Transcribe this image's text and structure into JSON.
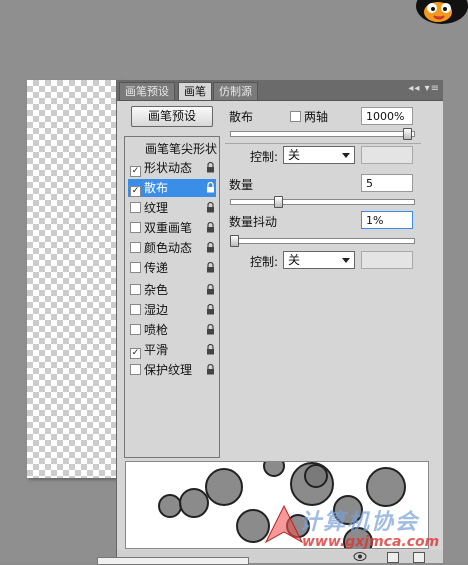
{
  "tabs": [
    {
      "label": "画笔预设",
      "active": false
    },
    {
      "label": "画笔",
      "active": true
    },
    {
      "label": "仿制源",
      "active": false
    }
  ],
  "tabbar_buttons": "◂◂ ▾≡",
  "preset_button": "画笔预设",
  "brush_tip_header": "画笔笔尖形状",
  "left_items": [
    {
      "label": "形状动态",
      "checked": true,
      "selected": false
    },
    {
      "label": "散布",
      "checked": true,
      "selected": true
    },
    {
      "label": "纹理",
      "checked": false,
      "selected": false
    },
    {
      "label": "双重画笔",
      "checked": false,
      "selected": false
    },
    {
      "label": "颜色动态",
      "checked": false,
      "selected": false
    },
    {
      "label": "传递",
      "checked": false,
      "selected": false
    },
    {
      "label": "杂色",
      "checked": false,
      "selected": false
    },
    {
      "label": "湿边",
      "checked": false,
      "selected": false
    },
    {
      "label": "喷枪",
      "checked": false,
      "selected": false
    },
    {
      "label": "平滑",
      "checked": true,
      "selected": false
    },
    {
      "label": "保护纹理",
      "checked": false,
      "selected": false
    }
  ],
  "scatter": {
    "label": "散布",
    "both_axes_label": "两轴",
    "both_axes_checked": false,
    "value": "1000%",
    "slider_fraction": 0.98
  },
  "control1": {
    "label": "控制:",
    "value": "关"
  },
  "count": {
    "label": "数量",
    "value": "5",
    "slider_fraction": 0.25
  },
  "count_jitter": {
    "label": "数量抖动",
    "value": "1%",
    "slider_fraction": 0.0
  },
  "control2": {
    "label": "控制:",
    "value": "关"
  },
  "watermark": {
    "text": "计算机协会",
    "url": "www.gxjmca.com"
  }
}
